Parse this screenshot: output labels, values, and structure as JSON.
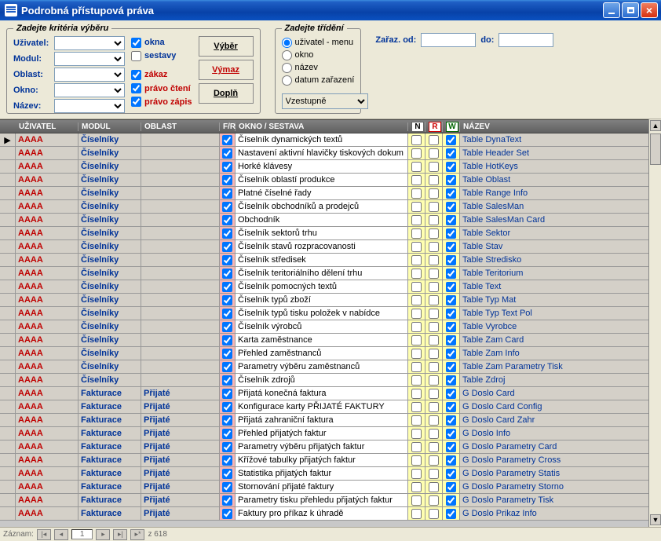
{
  "window": {
    "title": "Podrobná přístupová práva"
  },
  "filter": {
    "legend": "Zadejte kritéria výběru",
    "labels": {
      "uzivatel": "Uživatel:",
      "modul": "Modul:",
      "oblast": "Oblast:",
      "okno": "Okno:",
      "nazev": "Název:"
    },
    "checks": {
      "okna": "okna",
      "sestavy": "sestavy",
      "zakaz": "zákaz",
      "pravo_cteni": "právo čtení",
      "pravo_zapis": "právo zápis"
    },
    "check_state": {
      "okna": true,
      "sestavy": false,
      "zakaz": true,
      "pravo_cteni": true,
      "pravo_zapis": true
    },
    "buttons": {
      "vyber": "Výběr",
      "vymaz": "Výmaz",
      "dopln": "Doplň"
    }
  },
  "sort": {
    "legend": "Zadejte třídění",
    "options": {
      "uzivatel_menu": "uživatel - menu",
      "okno": "okno",
      "nazev": "název",
      "datum": "datum zařazení"
    },
    "direction": "Vzestupně"
  },
  "zaraz": {
    "od_label": "Zařaz. od:",
    "do_label": "do:",
    "od": "",
    "do": ""
  },
  "grid": {
    "headers": {
      "uzivatel": "UŽIVATEL",
      "modul": "MODUL",
      "oblast": "OBLAST",
      "fr": "F/R",
      "okno": "OKNO / SESTAVA",
      "n": "N",
      "r": "R",
      "w": "W",
      "nazev": "NÁZEV"
    },
    "rows": [
      {
        "u": "AAAA",
        "m": "Číselníky",
        "o": "",
        "fr": true,
        "okno": "Číselník dynamických textů",
        "n": false,
        "r": false,
        "w": true,
        "naz": "Table DynaText",
        "sel": true
      },
      {
        "u": "AAAA",
        "m": "Číselníky",
        "o": "",
        "fr": true,
        "okno": "Nastavení aktivní hlavičky tiskových dokum",
        "n": false,
        "r": false,
        "w": true,
        "naz": "Table Header Set"
      },
      {
        "u": "AAAA",
        "m": "Číselníky",
        "o": "",
        "fr": true,
        "okno": "Horké klávesy",
        "n": false,
        "r": false,
        "w": true,
        "naz": "Table HotKeys"
      },
      {
        "u": "AAAA",
        "m": "Číselníky",
        "o": "",
        "fr": true,
        "okno": "Číselník oblastí produkce",
        "n": false,
        "r": false,
        "w": true,
        "naz": "Table Oblast"
      },
      {
        "u": "AAAA",
        "m": "Číselníky",
        "o": "",
        "fr": true,
        "okno": "Platné číselné řady",
        "n": false,
        "r": false,
        "w": true,
        "naz": "Table Range Info"
      },
      {
        "u": "AAAA",
        "m": "Číselníky",
        "o": "",
        "fr": true,
        "okno": "Číselník obchodníků a prodejců",
        "n": false,
        "r": false,
        "w": true,
        "naz": "Table SalesMan"
      },
      {
        "u": "AAAA",
        "m": "Číselníky",
        "o": "",
        "fr": true,
        "okno": "Obchodník",
        "n": false,
        "r": false,
        "w": true,
        "naz": "Table SalesMan Card"
      },
      {
        "u": "AAAA",
        "m": "Číselníky",
        "o": "",
        "fr": true,
        "okno": "Číselník sektorů trhu",
        "n": false,
        "r": false,
        "w": true,
        "naz": "Table Sektor"
      },
      {
        "u": "AAAA",
        "m": "Číselníky",
        "o": "",
        "fr": true,
        "okno": "Číselník stavů rozpracovanosti",
        "n": false,
        "r": false,
        "w": true,
        "naz": "Table Stav"
      },
      {
        "u": "AAAA",
        "m": "Číselníky",
        "o": "",
        "fr": true,
        "okno": "Číselník středisek",
        "n": false,
        "r": false,
        "w": true,
        "naz": "Table Stredisko"
      },
      {
        "u": "AAAA",
        "m": "Číselníky",
        "o": "",
        "fr": true,
        "okno": "Číselník teritoriálního dělení trhu",
        "n": false,
        "r": false,
        "w": true,
        "naz": "Table Teritorium"
      },
      {
        "u": "AAAA",
        "m": "Číselníky",
        "o": "",
        "fr": true,
        "okno": "Číselník pomocných textů",
        "n": false,
        "r": false,
        "w": true,
        "naz": "Table Text"
      },
      {
        "u": "AAAA",
        "m": "Číselníky",
        "o": "",
        "fr": true,
        "okno": "Číselník typů zboží",
        "n": false,
        "r": false,
        "w": true,
        "naz": "Table Typ Mat"
      },
      {
        "u": "AAAA",
        "m": "Číselníky",
        "o": "",
        "fr": true,
        "okno": "Číselník typů tisku položek v nabídce",
        "n": false,
        "r": false,
        "w": true,
        "naz": "Table Typ Text Pol"
      },
      {
        "u": "AAAA",
        "m": "Číselníky",
        "o": "",
        "fr": true,
        "okno": "Číselník výrobců",
        "n": false,
        "r": false,
        "w": true,
        "naz": "Table Vyrobce"
      },
      {
        "u": "AAAA",
        "m": "Číselníky",
        "o": "",
        "fr": true,
        "okno": "Karta zaměstnance",
        "n": false,
        "r": false,
        "w": true,
        "naz": "Table Zam Card"
      },
      {
        "u": "AAAA",
        "m": "Číselníky",
        "o": "",
        "fr": true,
        "okno": "Přehled zaměstnanců",
        "n": false,
        "r": false,
        "w": true,
        "naz": "Table Zam Info"
      },
      {
        "u": "AAAA",
        "m": "Číselníky",
        "o": "",
        "fr": true,
        "okno": "Parametry výběru zaměstnanců",
        "n": false,
        "r": false,
        "w": true,
        "naz": "Table Zam Parametry Tisk"
      },
      {
        "u": "AAAA",
        "m": "Číselníky",
        "o": "",
        "fr": true,
        "okno": "Číselník zdrojů",
        "n": false,
        "r": false,
        "w": true,
        "naz": "Table Zdroj"
      },
      {
        "u": "AAAA",
        "m": "Fakturace",
        "o": "Přijaté",
        "fr": true,
        "okno": "Přijatá konečná faktura",
        "n": false,
        "r": false,
        "w": true,
        "naz": "G Doslo Card"
      },
      {
        "u": "AAAA",
        "m": "Fakturace",
        "o": "Přijaté",
        "fr": true,
        "okno": "Konfigurace karty PŘIJATÉ FAKTURY",
        "n": false,
        "r": false,
        "w": true,
        "naz": "G Doslo Card Config"
      },
      {
        "u": "AAAA",
        "m": "Fakturace",
        "o": "Přijaté",
        "fr": true,
        "okno": "Přijatá zahraniční faktura",
        "n": false,
        "r": false,
        "w": true,
        "naz": "G Doslo Card Zahr"
      },
      {
        "u": "AAAA",
        "m": "Fakturace",
        "o": "Přijaté",
        "fr": true,
        "okno": "Přehled přijatých faktur",
        "n": false,
        "r": false,
        "w": true,
        "naz": "G Doslo Info"
      },
      {
        "u": "AAAA",
        "m": "Fakturace",
        "o": "Přijaté",
        "fr": true,
        "okno": "Parametry výběru přijatých faktur",
        "n": false,
        "r": false,
        "w": true,
        "naz": "G Doslo Parametry Card"
      },
      {
        "u": "AAAA",
        "m": "Fakturace",
        "o": "Přijaté",
        "fr": true,
        "okno": "Křížové tabulky přijatých faktur",
        "n": false,
        "r": false,
        "w": true,
        "naz": "G Doslo Parametry Cross"
      },
      {
        "u": "AAAA",
        "m": "Fakturace",
        "o": "Přijaté",
        "fr": true,
        "okno": "Statistika přijatých faktur",
        "n": false,
        "r": false,
        "w": true,
        "naz": "G Doslo Parametry Statis"
      },
      {
        "u": "AAAA",
        "m": "Fakturace",
        "o": "Přijaté",
        "fr": true,
        "okno": "Stornování přijaté faktury",
        "n": false,
        "r": false,
        "w": true,
        "naz": "G Doslo Parametry Storno"
      },
      {
        "u": "AAAA",
        "m": "Fakturace",
        "o": "Přijaté",
        "fr": true,
        "okno": "Parametry tisku přehledu přijatých faktur",
        "n": false,
        "r": false,
        "w": true,
        "naz": "G Doslo Parametry Tisk"
      },
      {
        "u": "AAAA",
        "m": "Fakturace",
        "o": "Přijaté",
        "fr": true,
        "okno": "Faktury pro příkaz k úhradě",
        "n": false,
        "r": false,
        "w": true,
        "naz": "G Doslo Prikaz Info"
      }
    ]
  },
  "status": {
    "rec_label": "Záznam:",
    "pos": "1",
    "total": "z 618"
  }
}
